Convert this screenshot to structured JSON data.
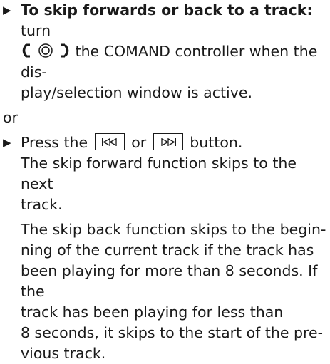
{
  "step1": {
    "bold": "To skip forwards or back to a track:",
    "text": "turn",
    "line2": "the COMAND controller when the dis-",
    "line3": "play/selection window is active."
  },
  "or_label": "or",
  "step2": {
    "before": "Press the",
    "middle": "or",
    "after": "button.",
    "prev_button_icon": "skip-back-icon",
    "next_button_icon": "skip-forward-icon"
  },
  "para1": {
    "line1": "The skip forward function skips to the next",
    "line2": "track."
  },
  "para2": {
    "line1": "The skip back function skips to the begin-",
    "line2": "ning of the current track if the track has",
    "line3": "been playing for more than 8 seconds. If the",
    "line4": "track has been playing for less than",
    "line5": "8 seconds, it skips to the start of the pre-",
    "line6": "vious track."
  },
  "icons": {
    "bullet": "triangle-bullet-icon",
    "controller": "comand-controller-rotate-icon"
  }
}
